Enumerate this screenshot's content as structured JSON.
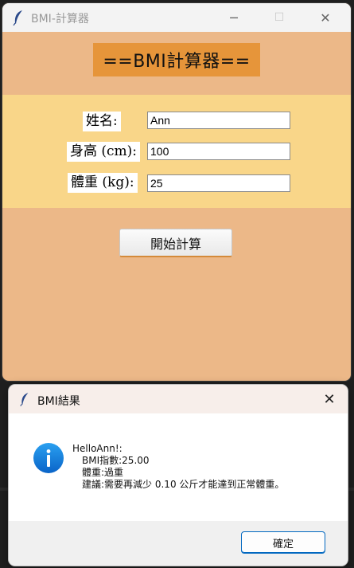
{
  "main_window": {
    "title": "BMI-計算器",
    "icon": "feather-icon",
    "controls": {
      "minimize": "─",
      "maximize": "☐",
      "close": "✕"
    }
  },
  "app": {
    "title": "==BMI計算器==",
    "form": {
      "name_label": "姓名:",
      "name_value": "Ann",
      "height_label": "身高 (cm):",
      "height_value": "100",
      "weight_label": "體重 (kg):",
      "weight_value": "25"
    },
    "start_button": "開始計算"
  },
  "dialog": {
    "title": "BMI結果",
    "close": "✕",
    "icon": "info-icon",
    "message": {
      "line1": "HelloAnn!:",
      "line2": "BMI指數:25.00",
      "line3": "體重:過重",
      "line4": "建議:需要再減少 0.10 公斤才能達到正常體重。"
    },
    "ok_button": "確定"
  },
  "colors": {
    "window_bg": "#ecb888",
    "title_bg": "#e6953a",
    "form_band": "#f9d689",
    "accent": "#0067c0"
  }
}
